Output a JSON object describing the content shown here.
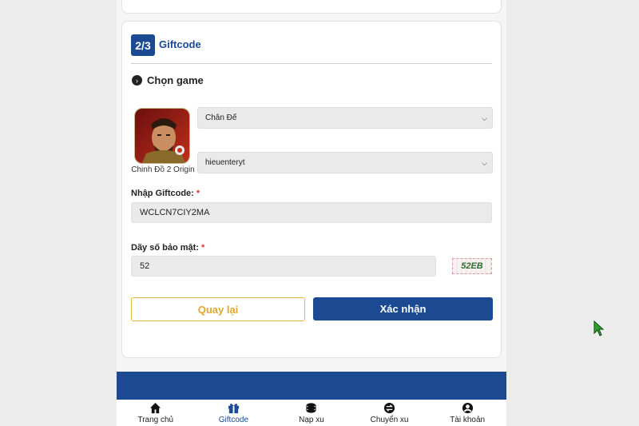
{
  "step": {
    "badge": "2/3",
    "title": "Giftcode"
  },
  "game_section": {
    "title": "Chọn game",
    "game_name": "Chinh Đồ 2 Origin",
    "server_select": "Chân Đế",
    "character_select": "hieuenteryt"
  },
  "giftcode": {
    "label": "Nhập Giftcode:",
    "required": "*",
    "value": "WCLCN7CIY2MA"
  },
  "security": {
    "label": "Dãy số bảo mật:",
    "required": "*",
    "value": "52",
    "captcha_text": "52EB"
  },
  "buttons": {
    "back": "Quay lại",
    "confirm": "Xác nhận"
  },
  "bottom_nav": [
    {
      "label": "Trang chủ",
      "icon": "home-icon"
    },
    {
      "label": "Giftcode",
      "icon": "gift-icon"
    },
    {
      "label": "Nạp xu",
      "icon": "coins-icon"
    },
    {
      "label": "Chuyển xu",
      "icon": "transfer-icon"
    },
    {
      "label": "Tài khoản",
      "icon": "user-icon"
    }
  ],
  "colors": {
    "primary": "#1b4a93",
    "accent": "#e3a72a",
    "required": "#d33333",
    "cursor": "#2ea02e"
  }
}
